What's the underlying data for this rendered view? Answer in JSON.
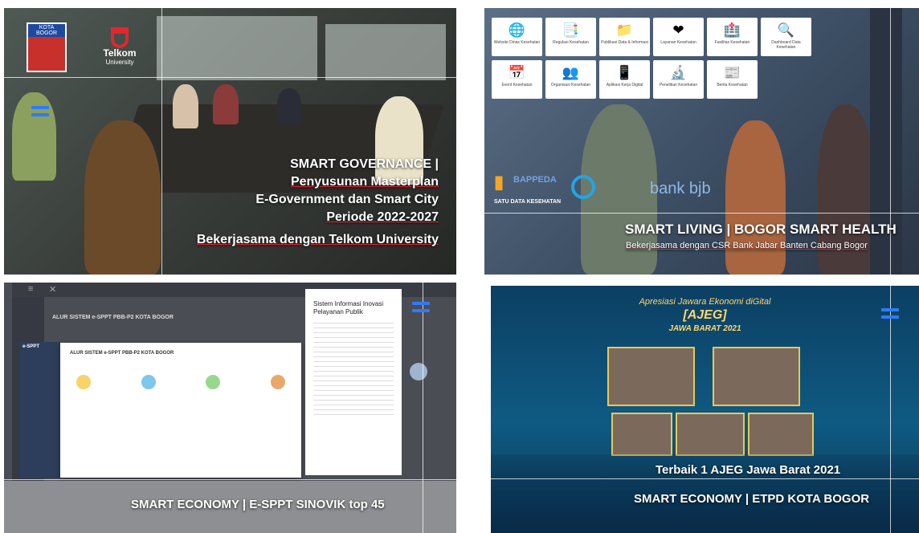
{
  "panels": {
    "governance": {
      "logo_kota": "KOTA BOGOR",
      "logo_telkom_name": "Telkom",
      "logo_telkom_sub": "University",
      "caption_lines": [
        "SMART GOVERNANCE |",
        "Penyusunan Masterplan",
        "E-Government dan Smart City",
        "Periode 2022-2027",
        "Bekerjasama dengan Telkom University"
      ]
    },
    "living": {
      "tiles": [
        {
          "icon": "globe-icon",
          "glyph": "🌐",
          "label": "Website Dinas Kesehatan"
        },
        {
          "icon": "regulation-icon",
          "glyph": "📑",
          "label": "Regulasi Kesehatan"
        },
        {
          "icon": "folder-icon",
          "glyph": "📁",
          "label": "Publikasi Data & Informasi"
        },
        {
          "icon": "health-service-icon",
          "glyph": "❤",
          "label": "Layanan Kesehatan"
        },
        {
          "icon": "hospital-icon",
          "glyph": "🏥",
          "label": "Fasilitas Kesehatan"
        },
        {
          "icon": "dashboard-search-icon",
          "glyph": "🔍",
          "label": "Dashboard Data Kesehatan"
        },
        {
          "icon": "calendar-icon",
          "glyph": "📅",
          "label": "Event Kesehatan"
        },
        {
          "icon": "organization-icon",
          "glyph": "👥",
          "label": "Organisasi Kesehatan"
        },
        {
          "icon": "app-icon",
          "glyph": "📱",
          "label": "Aplikasi Kerja Digital"
        },
        {
          "icon": "research-icon",
          "glyph": "🔬",
          "label": "Penelitian Kesehatan"
        },
        {
          "icon": "news-icon",
          "glyph": "📰",
          "label": "Berita Kesehatan"
        }
      ],
      "logo_satu_data": "SATU DATA KESEHATAN",
      "logo_bapenda": "BAPPEDA",
      "logo_bank": "bank bjb",
      "caption_title": "SMART LIVING | BOGOR SMART HEALTH",
      "caption_sub": "Bekerjasama dengan CSR Bank Jabar Banten Cabang Bogor"
    },
    "economy_sppt": {
      "doc_header": "ALUR SISTEM e-SPPT PBB-P2 KOTA BOGOR",
      "doc_inner_title": "ALUR SISTEM e-SPPT PBB-P2 KOTA BOGOR",
      "right_doc_title": "Sistem Informasi Inovasi Pelayanan Publik",
      "brand": "e-SPPT",
      "caption": "SMART ECONOMY | E-SPPT SINOVIK top 45"
    },
    "economy_etpd": {
      "header_small": "Apresiasi Jawara Ekonomi diGital",
      "header_big": "[AJEG]",
      "header_region": "JAWA BARAT 2021",
      "caption_1": "Terbaik 1 AJEG Jawa Barat 2021",
      "caption_2": "SMART ECONOMY | ETPD KOTA BOGOR"
    }
  },
  "colors": {
    "accent_marker": "#2f7bf6",
    "ajeg_gold": "#ffd76a",
    "telkom_red": "#e4262a"
  }
}
